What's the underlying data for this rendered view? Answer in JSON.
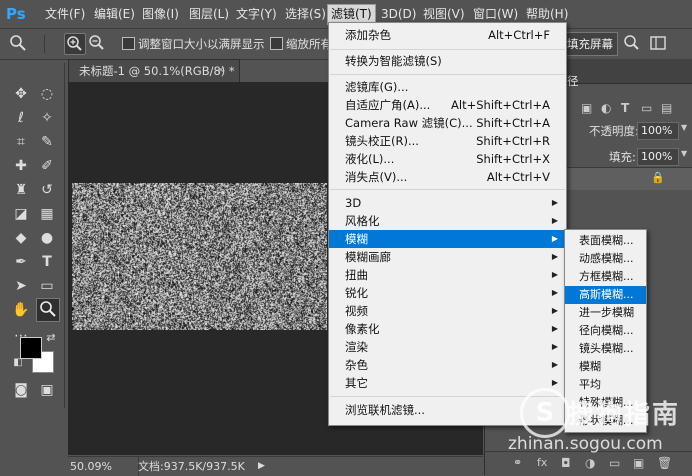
{
  "app": {
    "logo": "Ps"
  },
  "menubar": {
    "items": [
      "文件(F)",
      "编辑(E)",
      "图像(I)",
      "图层(L)",
      "文字(Y)",
      "选择(S)",
      "滤镜(T)",
      "3D(D)",
      "视图(V)",
      "窗口(W)",
      "帮助(H)"
    ],
    "active": "滤镜(T)"
  },
  "options": {
    "resize_window": "调整窗口大小以满屏显示",
    "zoom_all": "缩放所有",
    "fill_screen": "填充屏幕"
  },
  "document": {
    "tab_title": "未标题-1 @ 50.1%(RGB/8) *",
    "close_glyph": "×",
    "zoom": "50.09%",
    "doc_info": "文档:937.5K/937.5K"
  },
  "panel": {
    "tab_fragment": "径",
    "opacity_label": "不透明度:",
    "opacity_value": "100%",
    "fill_label": "填充:",
    "fill_value": "100%"
  },
  "filter_menu": {
    "items": [
      {
        "label": "添加杂色",
        "shortcut": "Alt+Ctrl+F"
      },
      {
        "label": "转换为智能滤镜(S)",
        "shortcut": ""
      },
      {
        "label": "滤镜库(G)...",
        "shortcut": ""
      },
      {
        "label": "自适应广角(A)...",
        "shortcut": "Alt+Shift+Ctrl+A"
      },
      {
        "label": "Camera Raw 滤镜(C)...",
        "shortcut": "Shift+Ctrl+A"
      },
      {
        "label": "镜头校正(R)...",
        "shortcut": "Shift+Ctrl+R"
      },
      {
        "label": "液化(L)...",
        "shortcut": "Shift+Ctrl+X"
      },
      {
        "label": "消失点(V)...",
        "shortcut": "Alt+Ctrl+V"
      },
      {
        "label": "3D",
        "submenu": true
      },
      {
        "label": "风格化",
        "submenu": true
      },
      {
        "label": "模糊",
        "submenu": true,
        "highlighted": true
      },
      {
        "label": "模糊画廊",
        "submenu": true
      },
      {
        "label": "扭曲",
        "submenu": true
      },
      {
        "label": "锐化",
        "submenu": true
      },
      {
        "label": "视频",
        "submenu": true
      },
      {
        "label": "像素化",
        "submenu": true
      },
      {
        "label": "渲染",
        "submenu": true
      },
      {
        "label": "杂色",
        "submenu": true
      },
      {
        "label": "其它",
        "submenu": true
      },
      {
        "label": "浏览联机滤镜...",
        "shortcut": ""
      }
    ]
  },
  "blur_submenu": {
    "items": [
      {
        "label": "表面模糊..."
      },
      {
        "label": "动感模糊..."
      },
      {
        "label": "方框模糊..."
      },
      {
        "label": "高斯模糊...",
        "highlighted": true
      },
      {
        "label": "进一步模糊"
      },
      {
        "label": "径向模糊..."
      },
      {
        "label": "镜头模糊..."
      },
      {
        "label": "模糊"
      },
      {
        "label": "平均"
      },
      {
        "label": "特殊模糊..."
      },
      {
        "label": "形状模糊..."
      }
    ]
  },
  "watermark": {
    "logo": "S",
    "text": "搜狗指南",
    "url": "zhinan.sogou.com"
  },
  "colors": {
    "accent": "#0078d7",
    "ps_blue": "#31a8ff"
  }
}
